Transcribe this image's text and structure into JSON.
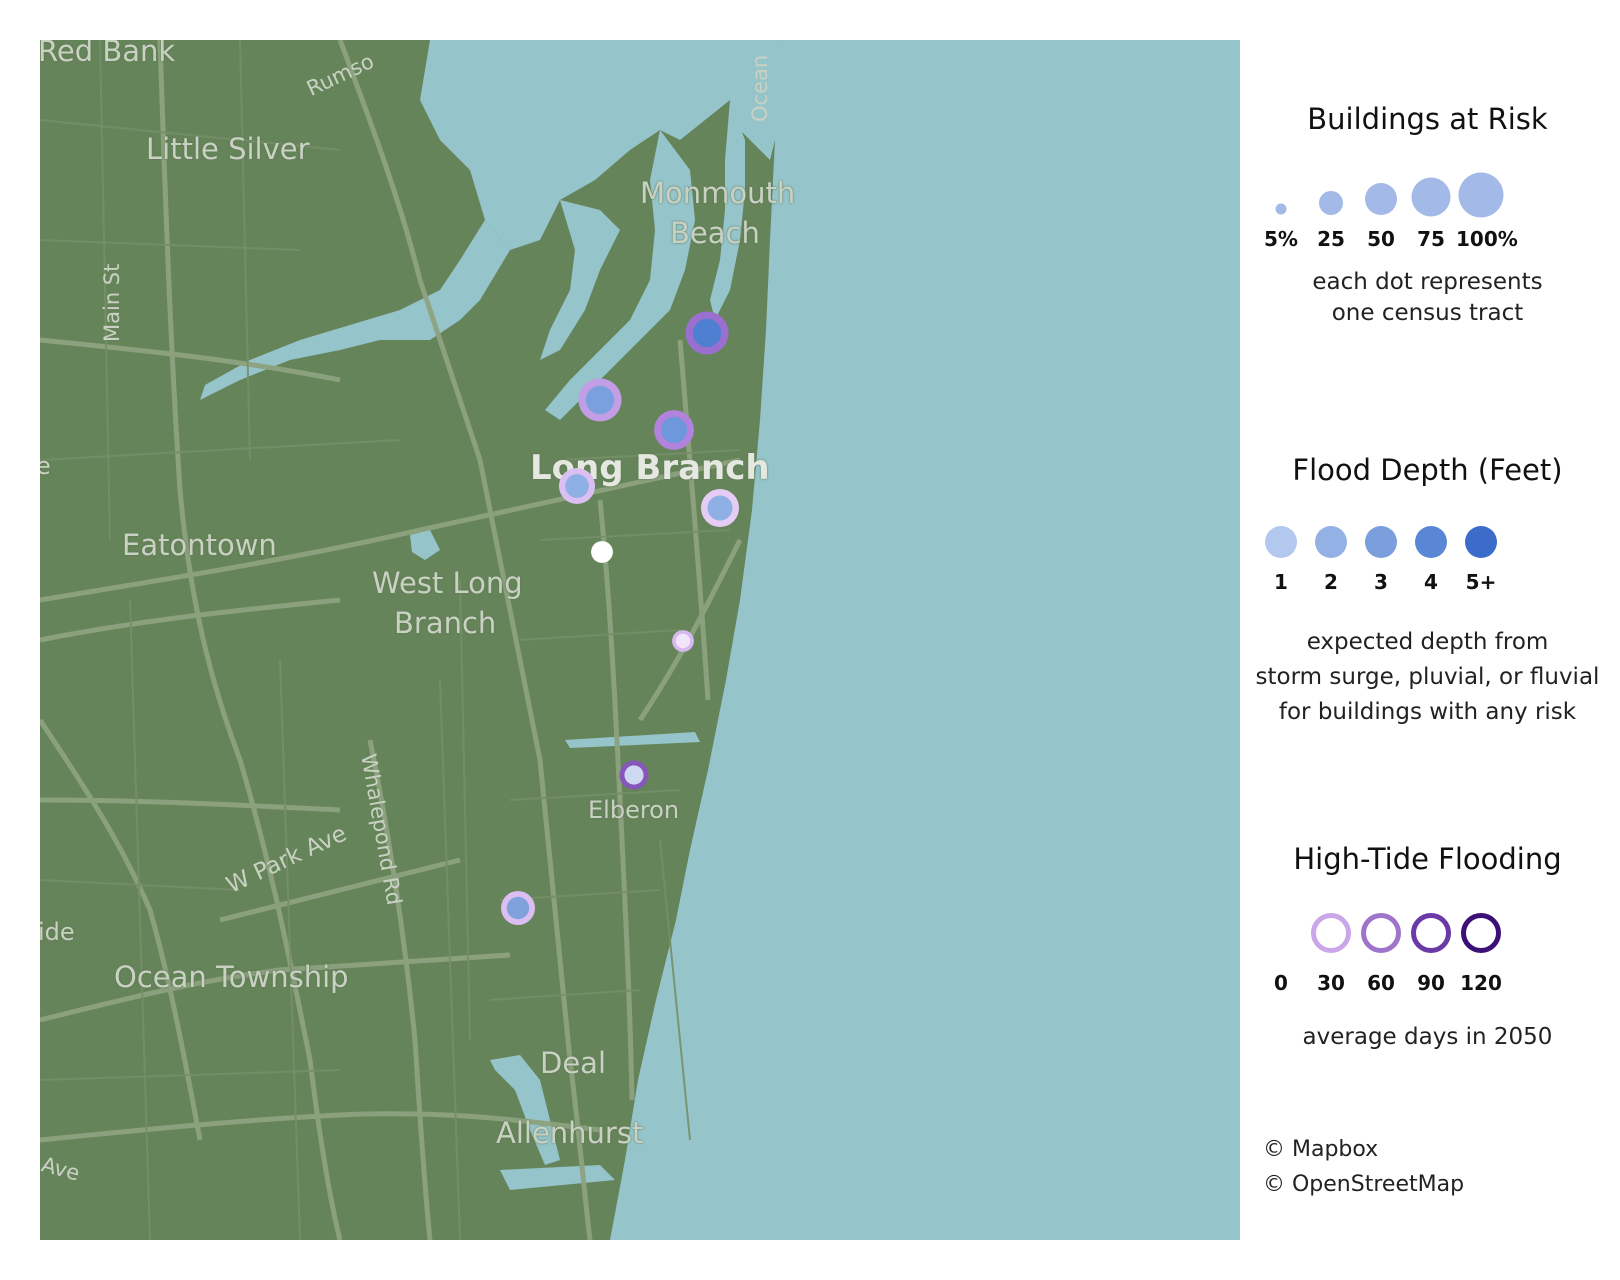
{
  "map": {
    "places": [
      {
        "name": "red-bank-label",
        "text": "Red Bank"
      },
      {
        "name": "little-silver-label",
        "text": "Little Silver"
      },
      {
        "name": "monmouth-beach-label-1",
        "text": "Monmouth"
      },
      {
        "name": "monmouth-beach-label-2",
        "text": "Beach"
      },
      {
        "name": "long-branch-label",
        "text": "Long Branch"
      },
      {
        "name": "eatontown-label",
        "text": "Eatontown"
      },
      {
        "name": "west-long-branch-label-1",
        "text": "West Long"
      },
      {
        "name": "west-long-branch-label-2",
        "text": "Branch"
      },
      {
        "name": "elberon-label",
        "text": "Elberon"
      },
      {
        "name": "ocean-township-label",
        "text": "Ocean Township"
      },
      {
        "name": "deal-label",
        "text": "Deal"
      },
      {
        "name": "allenhurst-label",
        "text": "Allenhurst"
      },
      {
        "name": "edge-label-ide",
        "text": "ide"
      },
      {
        "name": "edge-label-e",
        "text": "e"
      }
    ],
    "roads": [
      {
        "name": "main-st-label",
        "text": "Main St"
      },
      {
        "name": "rumson-label",
        "text": "Rumso"
      },
      {
        "name": "ocean-ave-label",
        "text": "Ocean"
      },
      {
        "name": "w-park-ave-label",
        "text": "W Park Ave"
      },
      {
        "name": "whalepond-rd-label",
        "text": "Whalepond Rd"
      },
      {
        "name": "ave-label",
        "text": "Ave"
      }
    ],
    "tracts": [
      {
        "label": "tract-monmouth-beach",
        "risk_pct": 50,
        "depth_color": "#4e7fd0",
        "tide_color": "#9b6fcf"
      },
      {
        "label": "tract-north-long-branch-west",
        "risk_pct": 50,
        "depth_color": "#7aa1de",
        "tide_color": "#c39de6"
      },
      {
        "label": "tract-north-long-branch-east",
        "risk_pct": 40,
        "depth_color": "#6f97db",
        "tide_color": "#b283dc"
      },
      {
        "label": "tract-long-branch-center",
        "risk_pct": 30,
        "depth_color": "#8fb0e4",
        "tide_color": "#dcbff2"
      },
      {
        "label": "tract-long-branch-beach",
        "risk_pct": 35,
        "depth_color": "#8fb0e4",
        "tide_color": "#e6ccf5"
      },
      {
        "label": "tract-long-branch-south",
        "risk_pct": 5,
        "depth_color": "#ffffff",
        "tide_color": "#ffffff"
      },
      {
        "label": "tract-long-branch-shore",
        "risk_pct": 5,
        "depth_color": "#f1e4fb",
        "tide_color": "#d6b7f0"
      },
      {
        "label": "tract-elberon",
        "risk_pct": 15,
        "depth_color": "#cfd8f2",
        "tide_color": "#8656bb"
      },
      {
        "label": "tract-ocean-township",
        "risk_pct": 25,
        "depth_color": "#7fa2dd",
        "tide_color": "#dcbff2"
      }
    ]
  },
  "legend": {
    "risk": {
      "title": "Buildings at Risk",
      "items": [
        {
          "label": "5%",
          "size": 5
        },
        {
          "label": "25",
          "size": 25
        },
        {
          "label": "50",
          "size": 50
        },
        {
          "label": "75",
          "size": 75
        },
        {
          "label": "100%",
          "size": 100
        }
      ],
      "note_1": "each dot represents",
      "note_2": "one census tract",
      "color": "#a3b9e7"
    },
    "depth": {
      "title": "Flood Depth (Feet)",
      "items": [
        {
          "label": "1",
          "color": "#b3c8ee"
        },
        {
          "label": "2",
          "color": "#94b1e6"
        },
        {
          "label": "3",
          "color": "#7b9edd"
        },
        {
          "label": "4",
          "color": "#5a86d6"
        },
        {
          "label": "5+",
          "color": "#3c6cca"
        }
      ],
      "note_1": "expected depth from",
      "note_2": "storm surge, pluvial, or fluvial",
      "note_3": "for buildings with any risk"
    },
    "tide": {
      "title": "High-Tide Flooding",
      "items": [
        {
          "label": "0",
          "color": "none"
        },
        {
          "label": "30",
          "color": "#c9a7e8"
        },
        {
          "label": "60",
          "color": "#9e75cb"
        },
        {
          "label": "90",
          "color": "#6a3aa6"
        },
        {
          "label": "120",
          "color": "#3d1078"
        }
      ],
      "note": "average days in 2050"
    }
  },
  "credits": {
    "mapbox": "© Mapbox",
    "osm": "© OpenStreetMap"
  },
  "colors": {
    "land": "#66845a",
    "water": "#95c4cb",
    "roads": "#8ea27f"
  }
}
